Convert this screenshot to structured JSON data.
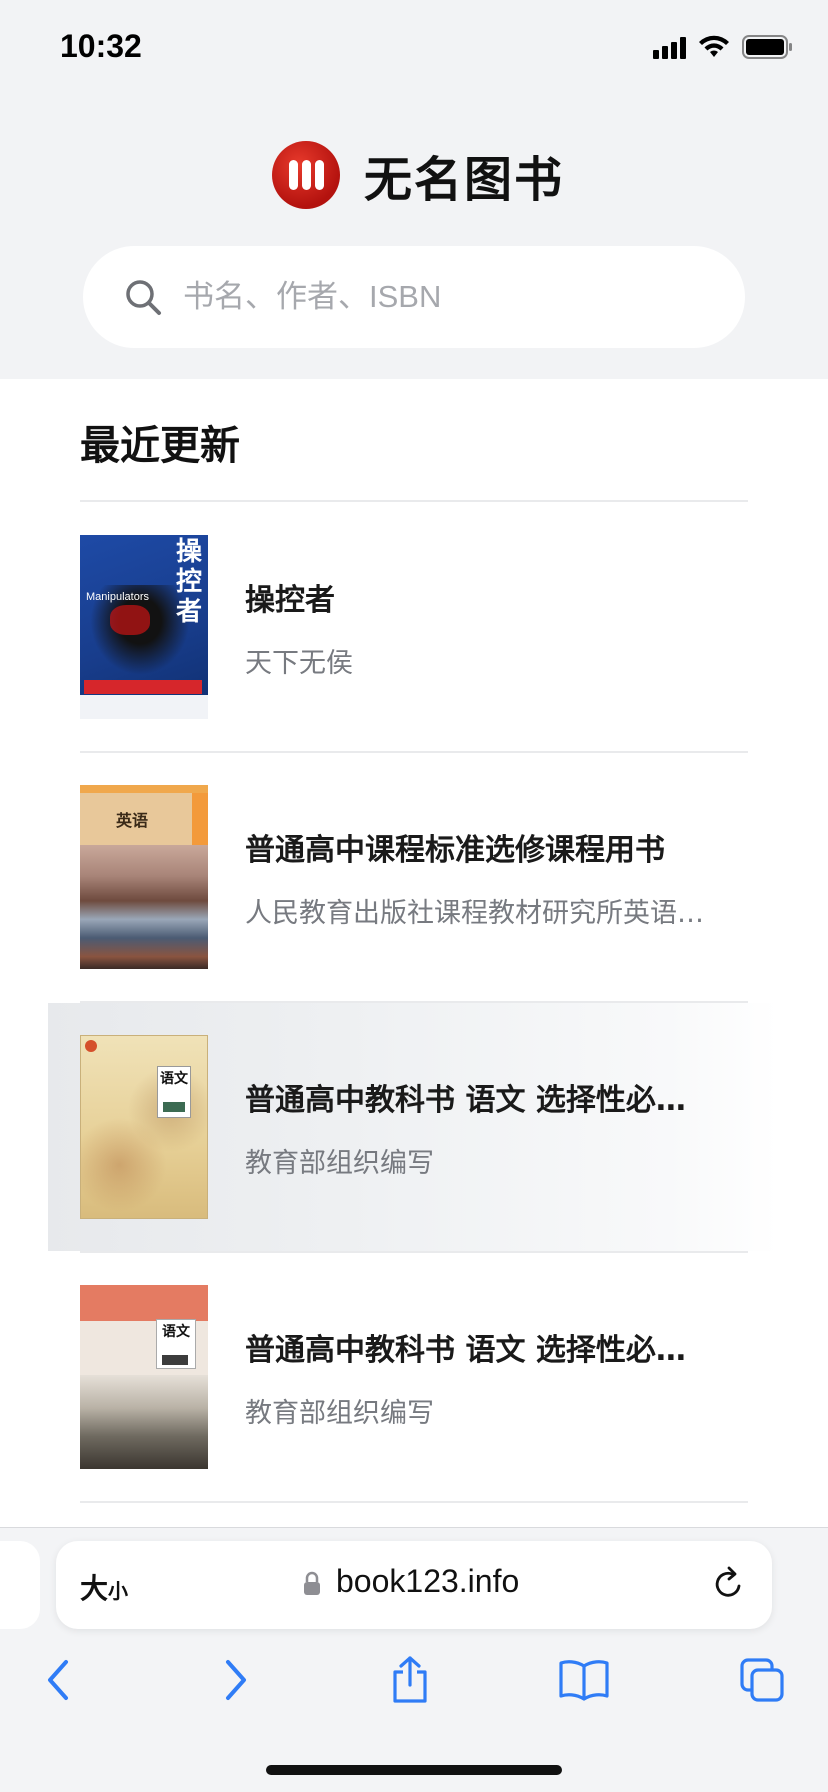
{
  "status": {
    "time": "10:32"
  },
  "brand": {
    "title": "无名图书"
  },
  "search": {
    "placeholder": "书名、作者、ISBN"
  },
  "section": {
    "title": "最近更新"
  },
  "books": [
    {
      "title": "操控者",
      "author": "天下无侯",
      "cover_title": "操控者",
      "cover_subtitle": "Manipulators"
    },
    {
      "title": "普通高中课程标准选修课程用书",
      "author": "人民教育出版社课程教材研究所英语…",
      "cover_title": "英语"
    },
    {
      "title": "普通高中教科书 语文 选择性必…",
      "author": "教育部组织编写",
      "cover_title": "语文"
    },
    {
      "title": "普通高中教科书 语文 选择性必…",
      "author": "教育部组织编写",
      "cover_title": "语文"
    }
  ],
  "browser": {
    "text_size_label": "大",
    "text_size_small": "小",
    "url": "book123.info"
  },
  "colors": {
    "brand_red": "#c8191a",
    "accent_blue": "#2f7cf6"
  },
  "icons": [
    "search-icon",
    "lock-icon",
    "reload-icon",
    "back-icon",
    "forward-icon",
    "share-icon",
    "bookmarks-icon",
    "tabs-icon"
  ]
}
